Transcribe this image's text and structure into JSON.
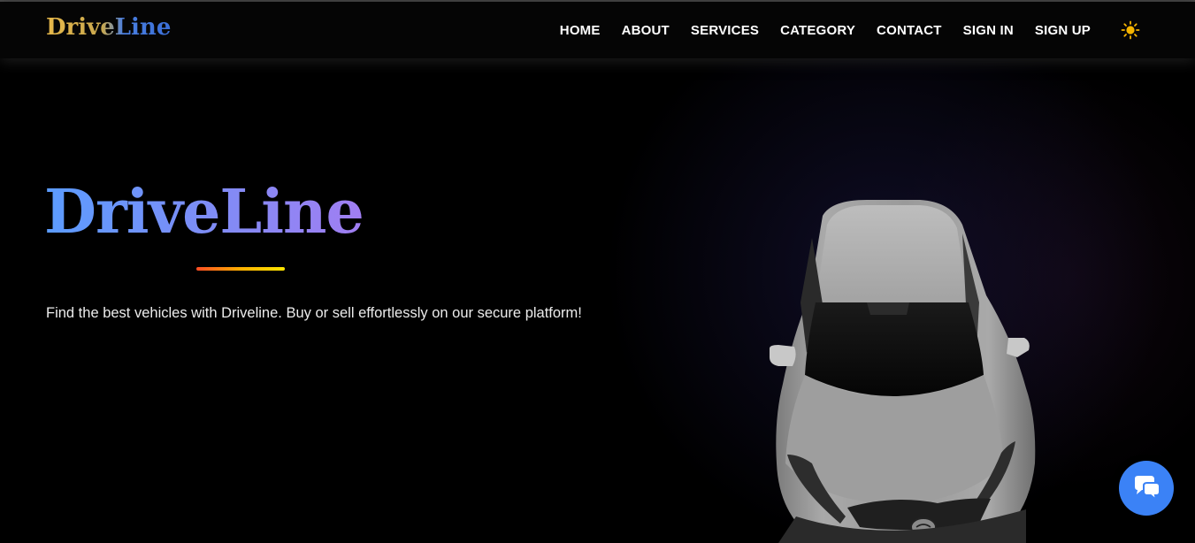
{
  "navbar": {
    "brand": "DriveLine",
    "links": [
      {
        "label": "HOME"
      },
      {
        "label": "ABOUT"
      },
      {
        "label": "SERVICES"
      },
      {
        "label": "CATEGORY"
      },
      {
        "label": "CONTACT"
      },
      {
        "label": "SIGN IN"
      },
      {
        "label": "SIGN UP"
      }
    ],
    "theme_toggle_icon": "sun-icon"
  },
  "hero": {
    "title": "DriveLine",
    "tagline": "Find the best vehicles with Driveline. Buy or sell effortlessly on our secure platform!",
    "image": "car-image"
  },
  "chat": {
    "icon": "chat-icon",
    "color": "#3b82f6"
  },
  "colors": {
    "background": "#000000",
    "brand_gold": "#e6b84a",
    "brand_blue": "#3b6fd8",
    "title_gradient_start": "#5b9cff",
    "title_gradient_end": "#a17ef2",
    "underline_start": "#ff4d24",
    "underline_end": "#ffe600",
    "sun": "#f5b400"
  }
}
